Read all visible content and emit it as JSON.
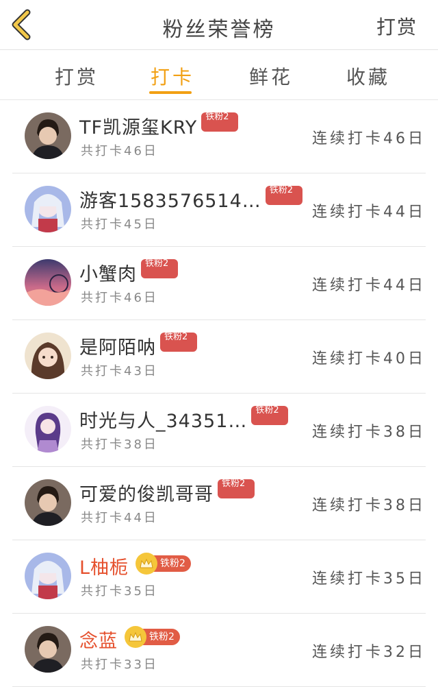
{
  "header": {
    "title": "粉丝荣誉榜",
    "reward_button": "打赏"
  },
  "tabs": [
    {
      "label": "打赏",
      "active": false
    },
    {
      "label": "打卡",
      "active": true
    },
    {
      "label": "鲜花",
      "active": false
    },
    {
      "label": "收藏",
      "active": false
    }
  ],
  "colors": {
    "accent": "#f2a014",
    "badge": "#d9534f",
    "vip_name": "#e5502d"
  },
  "fans": [
    {
      "name": "TF凯源玺KRY",
      "badge": "铁粉2",
      "badge_style": "plain",
      "vip": false,
      "total": "共打卡46日",
      "streak": "连续打卡46日",
      "avatar": "avatar-photo-boy"
    },
    {
      "name": "游客1583576514…",
      "badge": "铁粉2",
      "badge_style": "plain",
      "vip": false,
      "total": "共打卡45日",
      "streak": "连续打卡44日",
      "avatar": "avatar-anime-girl"
    },
    {
      "name": "小蟹肉",
      "badge": "铁粉2",
      "badge_style": "plain",
      "vip": false,
      "total": "共打卡46日",
      "streak": "连续打卡44日",
      "avatar": "avatar-sunset"
    },
    {
      "name": "是阿陌呐",
      "badge": "铁粉2",
      "badge_style": "plain",
      "vip": false,
      "total": "共打卡43日",
      "streak": "连续打卡40日",
      "avatar": "avatar-illustration"
    },
    {
      "name": "时光与人_34351…",
      "badge": "铁粉2",
      "badge_style": "plain",
      "vip": false,
      "total": "共打卡38日",
      "streak": "连续打卡38日",
      "avatar": "avatar-purple-girl"
    },
    {
      "name": "可爱的俊凯哥哥",
      "badge": "铁粉2",
      "badge_style": "plain",
      "vip": false,
      "total": "共打卡44日",
      "streak": "连续打卡38日",
      "avatar": "avatar-photo-boy"
    },
    {
      "name": "L柚栀",
      "badge": "铁粉2",
      "badge_style": "crown",
      "vip": true,
      "total": "共打卡35日",
      "streak": "连续打卡35日",
      "avatar": "avatar-anime-girl"
    },
    {
      "name": "念蓝",
      "badge": "铁粉2",
      "badge_style": "crown",
      "vip": true,
      "total": "共打卡33日",
      "streak": "连续打卡32日",
      "avatar": "avatar-photo-boy"
    }
  ]
}
